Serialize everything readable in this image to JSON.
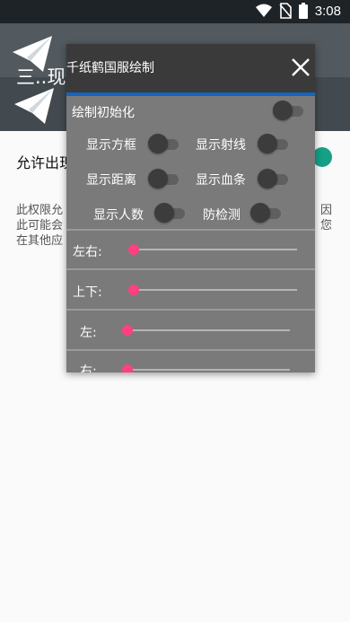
{
  "status": {
    "time": "3:08"
  },
  "app": {
    "title": "三..现在...."
  },
  "permission": {
    "label": "允许出现",
    "description_lines": [
      "此权限允",
      "此可能会",
      "在其他应"
    ],
    "right_fragments": [
      "因",
      "您"
    ]
  },
  "panel": {
    "title": "千纸鹤国服绘制",
    "toggles": {
      "init": {
        "label": "绘制初始化",
        "on": false
      },
      "box": {
        "label": "显示方框",
        "on": false
      },
      "ray": {
        "label": "显示射线",
        "on": false
      },
      "distance": {
        "label": "显示距离",
        "on": false
      },
      "health": {
        "label": "显示血条",
        "on": false
      },
      "count": {
        "label": "显示人数",
        "on": false
      },
      "anti": {
        "label": "防检测",
        "on": false
      }
    },
    "sliders": [
      {
        "label": "左右:",
        "value": 0
      },
      {
        "label": "上下:",
        "value": 0
      },
      {
        "label": "左:",
        "value": 0
      },
      {
        "label": "右:",
        "value": 0
      }
    ]
  },
  "colors": {
    "accent": "#1565c0",
    "slider": "#ff4081",
    "toggle_on": "#16a085"
  }
}
